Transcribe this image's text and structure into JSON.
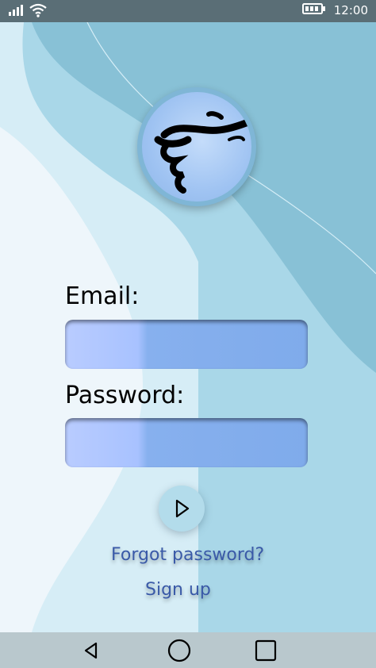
{
  "status_bar": {
    "time": "12:00",
    "icons": [
      "signal-icon",
      "wifi-icon",
      "battery-icon"
    ]
  },
  "logo": {
    "icon": "corkscrew-icon"
  },
  "form": {
    "email_label": "Email:",
    "email_value": "",
    "password_label": "Password:",
    "password_value": ""
  },
  "submit": {
    "icon": "play-icon"
  },
  "links": {
    "forgot_password": "Forgot password?",
    "sign_up": "Sign up"
  },
  "navigation": {
    "icons": [
      "back-icon",
      "home-icon",
      "recents-icon"
    ]
  },
  "colors": {
    "background": "#a9d7e8",
    "light_wave": "#eef6fb",
    "dark_wave": "#86bfd4",
    "field": "#7fabeb",
    "link": "#3a5aa8",
    "status_bar": "#5a6e76",
    "nav_bar": "#b9c8cd"
  }
}
